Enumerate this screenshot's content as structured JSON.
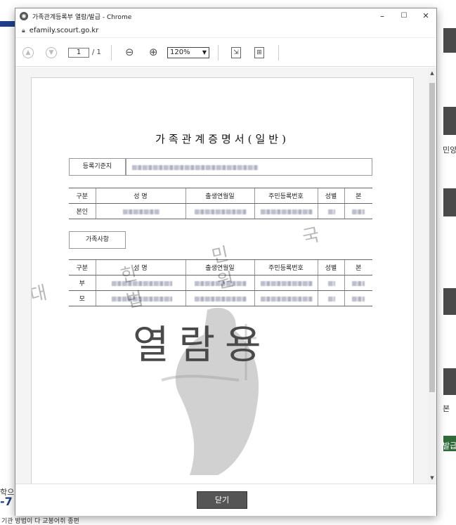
{
  "window": {
    "title": "가족관계등록부 열람/발급 - Chrome",
    "url": "efamily.scourt.go.kr",
    "minimize": "–",
    "maximize": "☐",
    "close": "✕"
  },
  "toolbar": {
    "page_current": "1",
    "page_total": "/ 1",
    "zoom": "120%"
  },
  "document": {
    "title": "가족관계증명서(일반)",
    "registry_label": "등록기준지",
    "headers": [
      "구분",
      "성   명",
      "출생연월일",
      "주민등록번호",
      "성별",
      "본"
    ],
    "self_row_label": "본인",
    "family_section_label": "가족사항",
    "family_rows": [
      "부",
      "모"
    ],
    "watermark_text": "열람용",
    "watermark_seal": "대 한 민 국 법 원"
  },
  "footer": {
    "close_label": "닫기"
  },
  "background": {
    "right_text_1": "민양",
    "right_text_2": "본",
    "right_text_3": "발급",
    "left_text_1": "학으",
    "left_text_2": "-7",
    "bottom_text": "기관 방법이 다 교봉어쥐 종편"
  }
}
